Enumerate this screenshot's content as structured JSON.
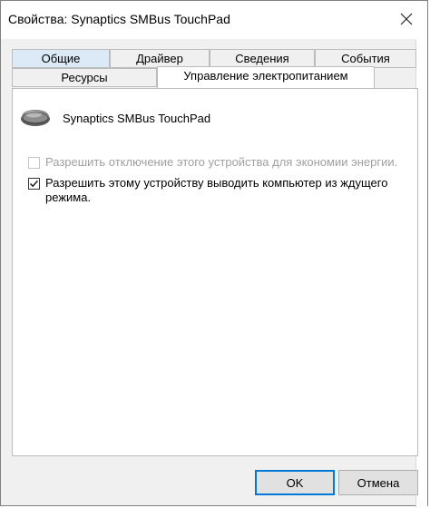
{
  "window": {
    "title": "Свойства: Synaptics SMBus TouchPad",
    "close_icon": "close-icon"
  },
  "tabs": {
    "row1": [
      "Общие",
      "Драйвер",
      "Сведения",
      "События"
    ],
    "row2": [
      "Ресурсы",
      "Управление электропитанием"
    ],
    "active": "Управление электропитанием"
  },
  "device": {
    "name": "Synaptics SMBus TouchPad",
    "icon": "touchpad-device-icon"
  },
  "options": [
    {
      "label": "Разрешить отключение этого устройства для экономии энергии.",
      "checked": false,
      "enabled": false
    },
    {
      "label": "Разрешить этому устройству выводить компьютер из ждущего режима.",
      "checked": true,
      "enabled": true
    }
  ],
  "buttons": {
    "ok": "OK",
    "cancel": "Отмена"
  },
  "colors": {
    "accent": "#0078d7",
    "disabled_text": "#a0a0a0"
  }
}
